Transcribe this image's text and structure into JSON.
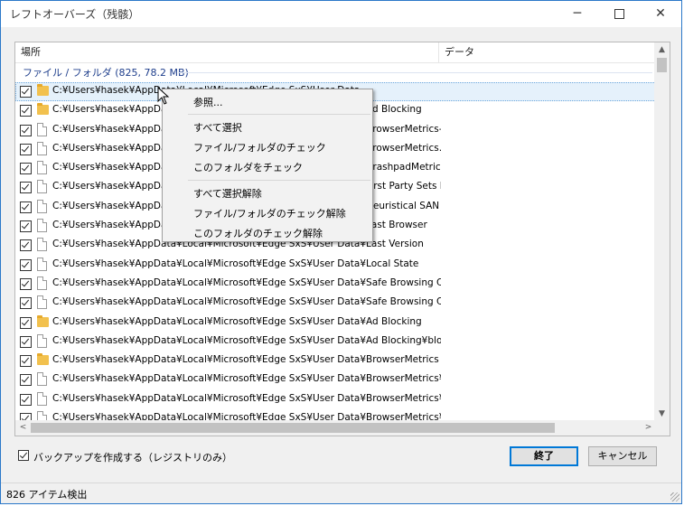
{
  "window": {
    "title": "レフトオーバーズ（残骸）"
  },
  "columns": {
    "place": "場所",
    "data": "データ"
  },
  "group": "ファイル / フォルダ (825, 78.2 MB)",
  "rows": [
    {
      "icon": "folder",
      "path": "C:¥Users¥hasek¥AppData¥Local¥Microsoft¥Edge SxS¥User Data"
    },
    {
      "icon": "folder",
      "path": "C:¥Users¥hasek¥AppData¥Local¥Microsoft¥Edge SxS¥User Data¥Ad Blocking"
    },
    {
      "icon": "file",
      "path": "C:¥Users¥hasek¥AppData¥Local¥Microsoft¥Edge SxS¥User Data¥BrowserMetrics-a..."
    },
    {
      "icon": "file",
      "path": "C:¥Users¥hasek¥AppData¥Local¥Microsoft¥Edge SxS¥User Data¥BrowserMetrics.pma"
    },
    {
      "icon": "file",
      "path": "C:¥Users¥hasek¥AppData¥Local¥Microsoft¥Edge SxS¥User Data¥CrashpadMetrics-active.pma"
    },
    {
      "icon": "file",
      "path": "C:¥Users¥hasek¥AppData¥Local¥Microsoft¥Edge SxS¥User Data¥First Party Sets Data"
    },
    {
      "icon": "file",
      "path": "C:¥Users¥hasek¥AppData¥Local¥Microsoft¥Edge SxS¥User Data¥Heuristical SAN Data"
    },
    {
      "icon": "file",
      "path": "C:¥Users¥hasek¥AppData¥Local¥Microsoft¥Edge SxS¥User Data¥Last Browser"
    },
    {
      "icon": "file",
      "path": "C:¥Users¥hasek¥AppData¥Local¥Microsoft¥Edge SxS¥User Data¥Last Version"
    },
    {
      "icon": "file",
      "path": "C:¥Users¥hasek¥AppData¥Local¥Microsoft¥Edge SxS¥User Data¥Local State"
    },
    {
      "icon": "file",
      "path": "C:¥Users¥hasek¥AppData¥Local¥Microsoft¥Edge SxS¥User Data¥Safe Browsing Coo..."
    },
    {
      "icon": "file",
      "path": "C:¥Users¥hasek¥AppData¥Local¥Microsoft¥Edge SxS¥User Data¥Safe Browsing Coo..."
    },
    {
      "icon": "folder",
      "path": "C:¥Users¥hasek¥AppData¥Local¥Microsoft¥Edge SxS¥User Data¥Ad Blocking"
    },
    {
      "icon": "file",
      "path": "C:¥Users¥hasek¥AppData¥Local¥Microsoft¥Edge SxS¥User Data¥Ad Blocking¥blocklist"
    },
    {
      "icon": "folder",
      "path": "C:¥Users¥hasek¥AppData¥Local¥Microsoft¥Edge SxS¥User Data¥BrowserMetrics"
    },
    {
      "icon": "file",
      "path": "C:¥Users¥hasek¥AppData¥Local¥Microsoft¥Edge SxS¥User Data¥BrowserMetrics¥Br..."
    },
    {
      "icon": "file",
      "path": "C:¥Users¥hasek¥AppData¥Local¥Microsoft¥Edge SxS¥User Data¥BrowserMetrics¥Br..."
    },
    {
      "icon": "file",
      "path": "C:¥Users¥hasek¥AppData¥Local¥Microsoft¥Edge SxS¥User Data¥BrowserMetrics¥Br..."
    }
  ],
  "context_menu": {
    "browse": "参照...",
    "select_all": "すべて選択",
    "check_files": "ファイル/フォルダのチェック",
    "check_folder": "このフォルダをチェック",
    "deselect_all": "すべて選択解除",
    "uncheck_files": "ファイル/フォルダのチェック解除",
    "uncheck_folder": "このフォルダのチェック解除"
  },
  "backup_label": "バックアップを作成する（レジストリのみ）",
  "buttons": {
    "finish": "終了",
    "cancel": "キャンセル"
  },
  "status": "826 アイテム検出"
}
